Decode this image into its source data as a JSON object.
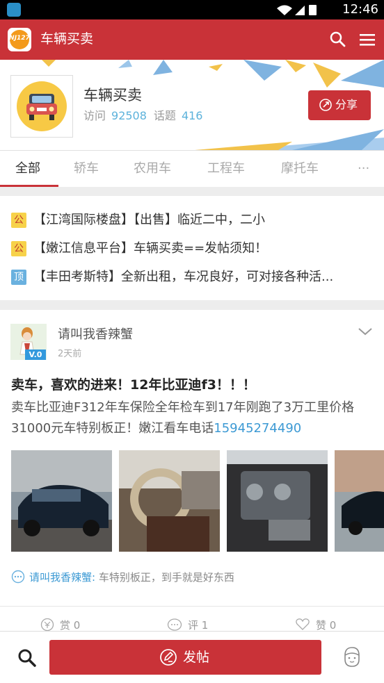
{
  "status_bar": {
    "time": "12:46"
  },
  "app_bar": {
    "logo_text": "NJ127",
    "title": "车辆买卖"
  },
  "forum": {
    "name": "车辆买卖",
    "visits_label": "访问",
    "visits": "92508",
    "topics_label": "话题",
    "topics": "416",
    "share_label": "分享"
  },
  "tabs": [
    {
      "label": "全部"
    },
    {
      "label": "轿车"
    },
    {
      "label": "农用车"
    },
    {
      "label": "工程车"
    },
    {
      "label": "摩托车"
    },
    {
      "label": "···"
    }
  ],
  "notices": [
    {
      "badge": "公",
      "text": "【江湾国际楼盘】【出售】临近二中，二小"
    },
    {
      "badge": "公",
      "text": "【嫩江信息平台】车辆买卖==发帖须知！"
    },
    {
      "badge": "顶",
      "text": "【丰田考斯特】全新出租，车况良好，可对接各种活..."
    }
  ],
  "post": {
    "user": "请叫我香辣蟹",
    "badge": "V.0",
    "time": "2天前",
    "title": "卖车，喜欢的进来！12年比亚迪f3！！！",
    "body": "卖车比亚迪F312年车保险全年检车到17年刚跑了3万工里价格31000元车特别板正！嫩江看车电话",
    "phone": "15945274490",
    "comment_user": "请叫我香辣蟹:",
    "comment_text": "车特别板正，到手就是好东西",
    "actions": {
      "reward": "赏 0",
      "comment": "评 1",
      "like": "赞 0"
    }
  },
  "bottom_bar": {
    "post_label": "发帖"
  },
  "colors": {
    "primary": "#c93238",
    "link": "#3d9ad4",
    "notice_badge": "#f7d24a",
    "top_badge": "#6ab1df"
  }
}
